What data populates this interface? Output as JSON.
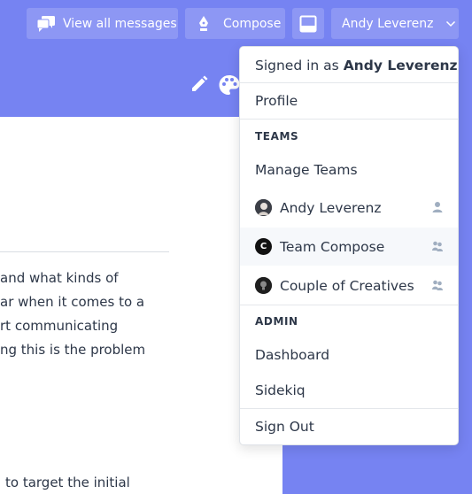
{
  "header": {
    "buttons": {
      "view_all": "View all messages",
      "compose": "Compose",
      "user": "Andy Leverenz"
    }
  },
  "content": {
    "lines": [
      "and what kinds of",
      "ar when it comes to a",
      "rt communicating",
      "ng this is the problem",
      "to target the initial"
    ]
  },
  "dropdown": {
    "signed_in_prefix": "Signed in as",
    "signed_in_name": "Andy Leverenz",
    "profile": "Profile",
    "teams_heading": "TEAMS",
    "manage_teams": "Manage Teams",
    "teams": [
      {
        "name": "Andy Leverenz",
        "kind": "person-icon"
      },
      {
        "name": "Team Compose",
        "kind": "group-icon",
        "avatar_letter": "C"
      },
      {
        "name": "Couple of Creatives",
        "kind": "group-icon"
      }
    ],
    "admin_heading": "ADMIN",
    "dashboard": "Dashboard",
    "sidekiq": "Sidekiq",
    "sign_out": "Sign Out"
  },
  "colors": {
    "header_bg": "#7683f2",
    "hover_row": "#f6f8fb",
    "text": "#2d3748"
  }
}
